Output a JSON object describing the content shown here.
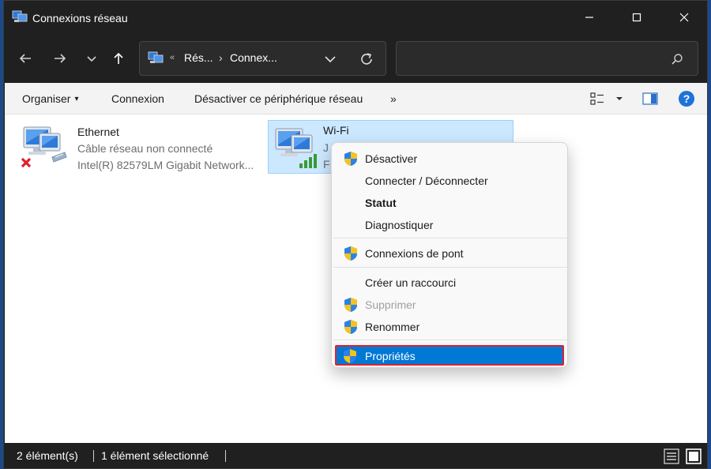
{
  "window": {
    "title": "Connexions réseau"
  },
  "address": {
    "overflow_glyph": "«",
    "crumbs": [
      "Rés...",
      "Connex..."
    ],
    "separator": "›"
  },
  "search": {
    "placeholder": "",
    "value": ""
  },
  "commandbar": {
    "organize": "Organiser",
    "organize_caret": "▾",
    "connect": "Connexion",
    "disable": "Désactiver ce périphérique réseau",
    "more": "»",
    "help": "?"
  },
  "items": [
    {
      "name": "Ethernet",
      "status": "Câble réseau non connecté",
      "device": "Intel(R) 82579LM Gigabit Network..."
    },
    {
      "name": "Wi-Fi",
      "status": "J",
      "device": "F"
    }
  ],
  "menu": {
    "items": [
      {
        "label": "Désactiver",
        "shield": true
      },
      {
        "label": "Connecter / Déconnecter",
        "shield": false
      },
      {
        "label": "Statut",
        "shield": false,
        "bold": true
      },
      {
        "label": "Diagnostiquer",
        "shield": false
      },
      {
        "label": "Connexions de pont",
        "shield": true
      },
      {
        "label": "Créer un raccourci",
        "shield": false
      },
      {
        "label": "Supprimer",
        "shield": true,
        "disabled": true
      },
      {
        "label": "Renommer",
        "shield": true
      },
      {
        "label": "Propriétés",
        "shield": true,
        "highlighted": true
      }
    ]
  },
  "status": {
    "count": "2 élément(s)",
    "selected": "1 élément sélectionné"
  },
  "colors": {
    "accent": "#0078d4",
    "highlight_border": "#e02030",
    "selection_bg": "#cce8ff",
    "titlebar": "#202020"
  }
}
